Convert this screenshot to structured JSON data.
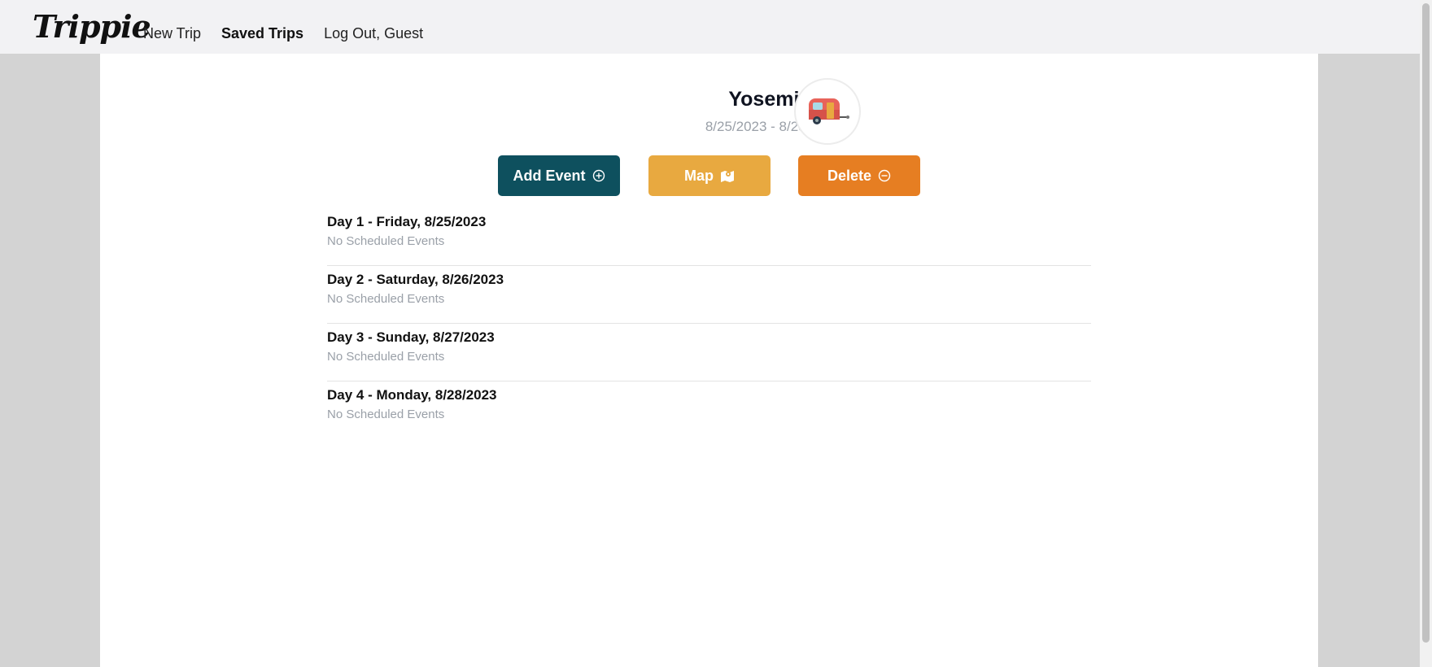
{
  "app": {
    "logo": "Trippie"
  },
  "nav": {
    "items": [
      {
        "label": "New Trip",
        "active": false
      },
      {
        "label": "Saved Trips",
        "active": true
      },
      {
        "label": "Log Out, Guest",
        "active": false
      }
    ]
  },
  "trip": {
    "name": "Yosemite",
    "dates": "8/25/2023 - 8/28/2023",
    "avatar_icon": "camper-trailer-icon"
  },
  "actions": {
    "add_label": "Add Event",
    "map_label": "Map",
    "delete_label": "Delete"
  },
  "colors": {
    "add": "#0e505e",
    "map": "#e8a940",
    "delete": "#e67e22"
  },
  "days": [
    {
      "title": "Day 1 - Friday, 8/25/2023",
      "status": "No Scheduled Events"
    },
    {
      "title": "Day 2 - Saturday, 8/26/2023",
      "status": "No Scheduled Events"
    },
    {
      "title": "Day 3 - Sunday, 8/27/2023",
      "status": "No Scheduled Events"
    },
    {
      "title": "Day 4 - Monday, 8/28/2023",
      "status": "No Scheduled Events"
    }
  ]
}
